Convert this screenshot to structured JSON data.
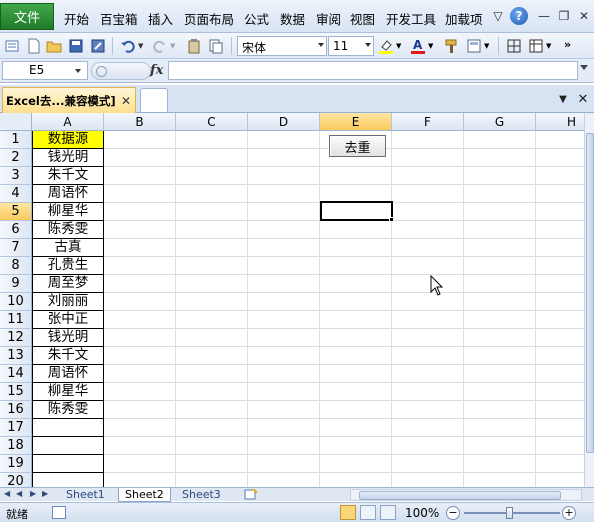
{
  "menu": {
    "file": "文件",
    "items": [
      "开始",
      "百宝箱",
      "插入",
      "页面布局",
      "公式",
      "数据",
      "审阅",
      "视图",
      "开发工具",
      "加载项"
    ],
    "help": "?"
  },
  "toolbar": {
    "font_name": "宋体",
    "font_size": "11"
  },
  "formula_bar": {
    "name_box": "E5",
    "fx_label": "fx",
    "formula": ""
  },
  "document_tab": {
    "title": "Excel去...兼容模式]",
    "close": "✕"
  },
  "grid": {
    "columns": [
      "A",
      "B",
      "C",
      "D",
      "E",
      "F",
      "G",
      "H"
    ],
    "selected_column": "E",
    "rows": [
      "1",
      "2",
      "3",
      "4",
      "5",
      "6",
      "7",
      "8",
      "9",
      "10",
      "11",
      "12",
      "13",
      "14",
      "15",
      "16",
      "17",
      "18",
      "19",
      "20"
    ],
    "selected_row": "5",
    "column_a": [
      "数据源",
      "钱光明",
      "朱千文",
      "周语怀",
      "柳星华",
      "陈秀雯",
      "古真",
      "孔贵生",
      "周至梦",
      "刘丽丽",
      "张中正",
      "钱光明",
      "朱千文",
      "周语怀",
      "柳星华",
      "陈秀雯",
      "",
      "",
      "",
      ""
    ],
    "active_cell": "E5"
  },
  "dedupe_button": {
    "label": "去重"
  },
  "sheets": {
    "tabs": [
      "Sheet1",
      "Sheet2",
      "Sheet3"
    ],
    "active": "Sheet2"
  },
  "status": {
    "text": "就绪",
    "zoom": "100%",
    "zoom_level": 1.0
  },
  "colors": {
    "header_yellow": "#ffff00",
    "file_button_green": "#2e8b35",
    "selection_highlight": "#f9c95a"
  }
}
